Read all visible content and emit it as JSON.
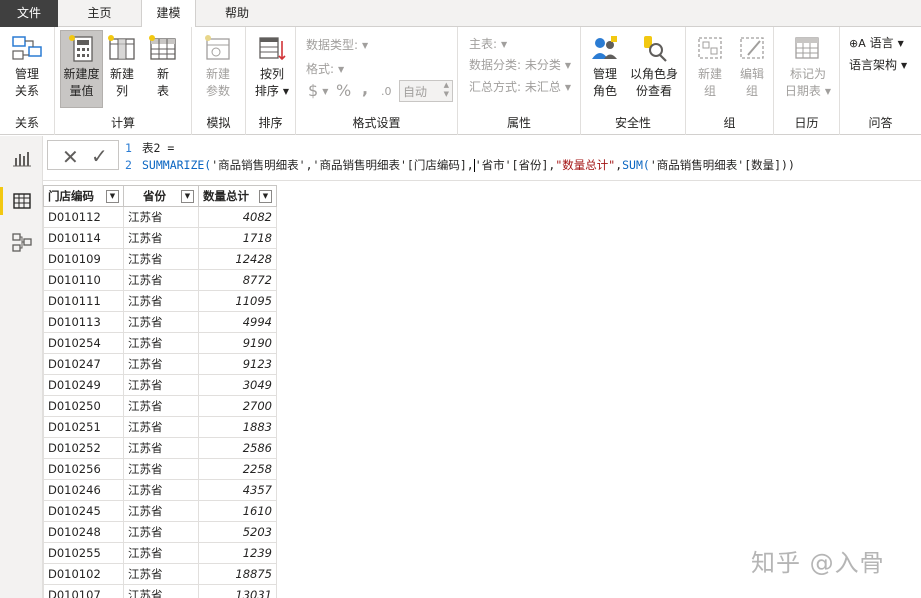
{
  "tabs": [
    {
      "label": "文件"
    },
    {
      "label": "主页"
    },
    {
      "label": "建模"
    },
    {
      "label": "帮助"
    }
  ],
  "ribbon": {
    "relations": {
      "btn": "管理\n关系",
      "btn_line1": "管理",
      "btn_line2": "关系",
      "group": "关系"
    },
    "calc": {
      "measure_l1": "新建度",
      "measure_l2": "量值",
      "column_l1": "新建",
      "column_l2": "列",
      "table_l1": "新",
      "table_l2": "表",
      "group": "计算"
    },
    "whatif": {
      "l1": "新建",
      "l2": "参数",
      "group": "模拟"
    },
    "sort": {
      "l1": "按列",
      "l2": "排序",
      "group": "排序"
    },
    "format": {
      "datatype": "数据类型:",
      "format": "格式:",
      "currency": "$",
      "percent": "%",
      "comma": ",",
      "decimal": ".0",
      "auto": "自动",
      "group": "格式设置"
    },
    "props": {
      "home_table": "主表:",
      "data_category": "数据分类: 未分类",
      "summarize": "汇总方式: 未汇总",
      "group": "属性"
    },
    "security": {
      "manage_l1": "管理",
      "manage_l2": "角色",
      "viewas_l1": "以角色身",
      "viewas_l2": "份查看",
      "group": "安全性"
    },
    "groups": {
      "new_l1": "新建",
      "new_l2": "组",
      "edit_l1": "编辑",
      "edit_l2": "组",
      "group": "组"
    },
    "calendar": {
      "l1": "标记为",
      "l2": "日期表",
      "group": "日历"
    },
    "qa": {
      "language": "语言",
      "schema": "语言架构",
      "group": "问答"
    }
  },
  "formula": {
    "line1_no": "1",
    "line1": "表2 =",
    "line2_no": "2",
    "line2_a": "SUMMARIZE(",
    "line2_b": "'商品销售明细表'",
    "line2_c": ",",
    "line2_d": "'商品销售明细表'",
    "line2_e": "[门店编码],",
    "line2_f": "'省市'",
    "line2_g": "[省份],",
    "line2_h": "\"数量总计\"",
    "line2_i": ",",
    "line2_j": "SUM(",
    "line2_k": "'商品销售明细表'",
    "line2_l": "[数量]))"
  },
  "grid": {
    "headers": [
      "门店编码",
      "省份",
      "数量总计"
    ],
    "rows": [
      [
        "D010112",
        "江苏省",
        "4082"
      ],
      [
        "D010114",
        "江苏省",
        "1718"
      ],
      [
        "D010109",
        "江苏省",
        "12428"
      ],
      [
        "D010110",
        "江苏省",
        "8772"
      ],
      [
        "D010111",
        "江苏省",
        "11095"
      ],
      [
        "D010113",
        "江苏省",
        "4994"
      ],
      [
        "D010254",
        "江苏省",
        "9190"
      ],
      [
        "D010247",
        "江苏省",
        "9123"
      ],
      [
        "D010249",
        "江苏省",
        "3049"
      ],
      [
        "D010250",
        "江苏省",
        "2700"
      ],
      [
        "D010251",
        "江苏省",
        "1883"
      ],
      [
        "D010252",
        "江苏省",
        "2586"
      ],
      [
        "D010256",
        "江苏省",
        "2258"
      ],
      [
        "D010246",
        "江苏省",
        "4357"
      ],
      [
        "D010245",
        "江苏省",
        "1610"
      ],
      [
        "D010248",
        "江苏省",
        "5203"
      ],
      [
        "D010255",
        "江苏省",
        "1239"
      ],
      [
        "D010102",
        "江苏省",
        "18875"
      ],
      [
        "D010107",
        "江苏省",
        "13031"
      ]
    ]
  },
  "watermark": "知乎 @入骨",
  "colors": {
    "accent_yellow": "#f2c811",
    "file_tab": "#404040",
    "code_blue": "#0b66c2",
    "code_red": "#a31515"
  }
}
